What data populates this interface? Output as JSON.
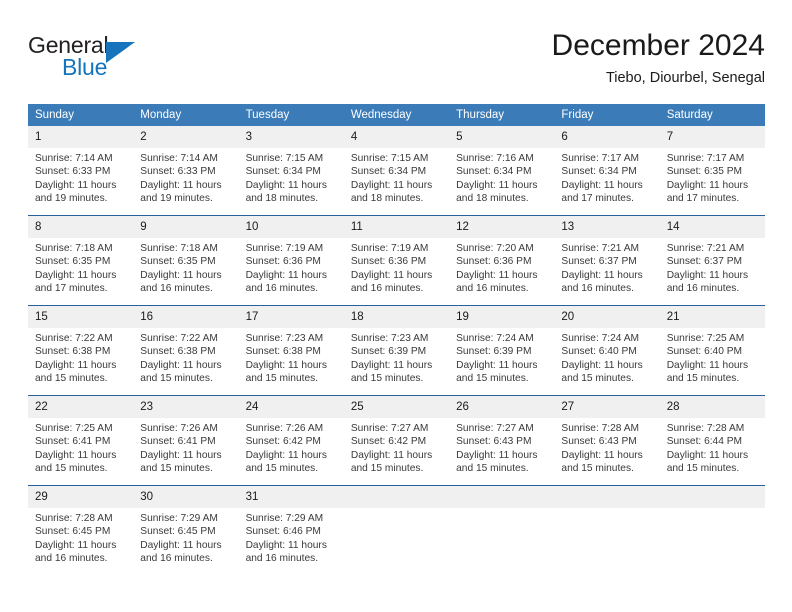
{
  "brand": {
    "name_part1": "General",
    "name_part2": "Blue",
    "triangle_icon": "brand-triangle-icon",
    "accent_color": "#1574bb"
  },
  "header": {
    "month_title": "December 2024",
    "location": "Tiebo, Diourbel, Senegal"
  },
  "theme": {
    "header_blue": "#3b7cb8",
    "separator_blue": "#2a6099",
    "daynum_band": "#f0f0f0",
    "text": "#1a1a1a"
  },
  "calendar": {
    "weekday_headers": [
      "Sunday",
      "Monday",
      "Tuesday",
      "Wednesday",
      "Thursday",
      "Friday",
      "Saturday"
    ],
    "labels": {
      "sunrise_prefix": "Sunrise:",
      "sunset_prefix": "Sunset:",
      "daylight_prefix": "Daylight:"
    },
    "weeks": [
      [
        {
          "day": "1",
          "sunrise": "Sunrise: 7:14 AM",
          "sunset": "Sunset: 6:33 PM",
          "daylight_line1": "Daylight: 11 hours",
          "daylight_line2": "and 19 minutes."
        },
        {
          "day": "2",
          "sunrise": "Sunrise: 7:14 AM",
          "sunset": "Sunset: 6:33 PM",
          "daylight_line1": "Daylight: 11 hours",
          "daylight_line2": "and 19 minutes."
        },
        {
          "day": "3",
          "sunrise": "Sunrise: 7:15 AM",
          "sunset": "Sunset: 6:34 PM",
          "daylight_line1": "Daylight: 11 hours",
          "daylight_line2": "and 18 minutes."
        },
        {
          "day": "4",
          "sunrise": "Sunrise: 7:15 AM",
          "sunset": "Sunset: 6:34 PM",
          "daylight_line1": "Daylight: 11 hours",
          "daylight_line2": "and 18 minutes."
        },
        {
          "day": "5",
          "sunrise": "Sunrise: 7:16 AM",
          "sunset": "Sunset: 6:34 PM",
          "daylight_line1": "Daylight: 11 hours",
          "daylight_line2": "and 18 minutes."
        },
        {
          "day": "6",
          "sunrise": "Sunrise: 7:17 AM",
          "sunset": "Sunset: 6:34 PM",
          "daylight_line1": "Daylight: 11 hours",
          "daylight_line2": "and 17 minutes."
        },
        {
          "day": "7",
          "sunrise": "Sunrise: 7:17 AM",
          "sunset": "Sunset: 6:35 PM",
          "daylight_line1": "Daylight: 11 hours",
          "daylight_line2": "and 17 minutes."
        }
      ],
      [
        {
          "day": "8",
          "sunrise": "Sunrise: 7:18 AM",
          "sunset": "Sunset: 6:35 PM",
          "daylight_line1": "Daylight: 11 hours",
          "daylight_line2": "and 17 minutes."
        },
        {
          "day": "9",
          "sunrise": "Sunrise: 7:18 AM",
          "sunset": "Sunset: 6:35 PM",
          "daylight_line1": "Daylight: 11 hours",
          "daylight_line2": "and 16 minutes."
        },
        {
          "day": "10",
          "sunrise": "Sunrise: 7:19 AM",
          "sunset": "Sunset: 6:36 PM",
          "daylight_line1": "Daylight: 11 hours",
          "daylight_line2": "and 16 minutes."
        },
        {
          "day": "11",
          "sunrise": "Sunrise: 7:19 AM",
          "sunset": "Sunset: 6:36 PM",
          "daylight_line1": "Daylight: 11 hours",
          "daylight_line2": "and 16 minutes."
        },
        {
          "day": "12",
          "sunrise": "Sunrise: 7:20 AM",
          "sunset": "Sunset: 6:36 PM",
          "daylight_line1": "Daylight: 11 hours",
          "daylight_line2": "and 16 minutes."
        },
        {
          "day": "13",
          "sunrise": "Sunrise: 7:21 AM",
          "sunset": "Sunset: 6:37 PM",
          "daylight_line1": "Daylight: 11 hours",
          "daylight_line2": "and 16 minutes."
        },
        {
          "day": "14",
          "sunrise": "Sunrise: 7:21 AM",
          "sunset": "Sunset: 6:37 PM",
          "daylight_line1": "Daylight: 11 hours",
          "daylight_line2": "and 16 minutes."
        }
      ],
      [
        {
          "day": "15",
          "sunrise": "Sunrise: 7:22 AM",
          "sunset": "Sunset: 6:38 PM",
          "daylight_line1": "Daylight: 11 hours",
          "daylight_line2": "and 15 minutes."
        },
        {
          "day": "16",
          "sunrise": "Sunrise: 7:22 AM",
          "sunset": "Sunset: 6:38 PM",
          "daylight_line1": "Daylight: 11 hours",
          "daylight_line2": "and 15 minutes."
        },
        {
          "day": "17",
          "sunrise": "Sunrise: 7:23 AM",
          "sunset": "Sunset: 6:38 PM",
          "daylight_line1": "Daylight: 11 hours",
          "daylight_line2": "and 15 minutes."
        },
        {
          "day": "18",
          "sunrise": "Sunrise: 7:23 AM",
          "sunset": "Sunset: 6:39 PM",
          "daylight_line1": "Daylight: 11 hours",
          "daylight_line2": "and 15 minutes."
        },
        {
          "day": "19",
          "sunrise": "Sunrise: 7:24 AM",
          "sunset": "Sunset: 6:39 PM",
          "daylight_line1": "Daylight: 11 hours",
          "daylight_line2": "and 15 minutes."
        },
        {
          "day": "20",
          "sunrise": "Sunrise: 7:24 AM",
          "sunset": "Sunset: 6:40 PM",
          "daylight_line1": "Daylight: 11 hours",
          "daylight_line2": "and 15 minutes."
        },
        {
          "day": "21",
          "sunrise": "Sunrise: 7:25 AM",
          "sunset": "Sunset: 6:40 PM",
          "daylight_line1": "Daylight: 11 hours",
          "daylight_line2": "and 15 minutes."
        }
      ],
      [
        {
          "day": "22",
          "sunrise": "Sunrise: 7:25 AM",
          "sunset": "Sunset: 6:41 PM",
          "daylight_line1": "Daylight: 11 hours",
          "daylight_line2": "and 15 minutes."
        },
        {
          "day": "23",
          "sunrise": "Sunrise: 7:26 AM",
          "sunset": "Sunset: 6:41 PM",
          "daylight_line1": "Daylight: 11 hours",
          "daylight_line2": "and 15 minutes."
        },
        {
          "day": "24",
          "sunrise": "Sunrise: 7:26 AM",
          "sunset": "Sunset: 6:42 PM",
          "daylight_line1": "Daylight: 11 hours",
          "daylight_line2": "and 15 minutes."
        },
        {
          "day": "25",
          "sunrise": "Sunrise: 7:27 AM",
          "sunset": "Sunset: 6:42 PM",
          "daylight_line1": "Daylight: 11 hours",
          "daylight_line2": "and 15 minutes."
        },
        {
          "day": "26",
          "sunrise": "Sunrise: 7:27 AM",
          "sunset": "Sunset: 6:43 PM",
          "daylight_line1": "Daylight: 11 hours",
          "daylight_line2": "and 15 minutes."
        },
        {
          "day": "27",
          "sunrise": "Sunrise: 7:28 AM",
          "sunset": "Sunset: 6:43 PM",
          "daylight_line1": "Daylight: 11 hours",
          "daylight_line2": "and 15 minutes."
        },
        {
          "day": "28",
          "sunrise": "Sunrise: 7:28 AM",
          "sunset": "Sunset: 6:44 PM",
          "daylight_line1": "Daylight: 11 hours",
          "daylight_line2": "and 15 minutes."
        }
      ],
      [
        {
          "day": "29",
          "sunrise": "Sunrise: 7:28 AM",
          "sunset": "Sunset: 6:45 PM",
          "daylight_line1": "Daylight: 11 hours",
          "daylight_line2": "and 16 minutes."
        },
        {
          "day": "30",
          "sunrise": "Sunrise: 7:29 AM",
          "sunset": "Sunset: 6:45 PM",
          "daylight_line1": "Daylight: 11 hours",
          "daylight_line2": "and 16 minutes."
        },
        {
          "day": "31",
          "sunrise": "Sunrise: 7:29 AM",
          "sunset": "Sunset: 6:46 PM",
          "daylight_line1": "Daylight: 11 hours",
          "daylight_line2": "and 16 minutes."
        },
        {
          "day": "",
          "sunrise": "",
          "sunset": "",
          "daylight_line1": "",
          "daylight_line2": ""
        },
        {
          "day": "",
          "sunrise": "",
          "sunset": "",
          "daylight_line1": "",
          "daylight_line2": ""
        },
        {
          "day": "",
          "sunrise": "",
          "sunset": "",
          "daylight_line1": "",
          "daylight_line2": ""
        },
        {
          "day": "",
          "sunrise": "",
          "sunset": "",
          "daylight_line1": "",
          "daylight_line2": ""
        }
      ]
    ]
  }
}
